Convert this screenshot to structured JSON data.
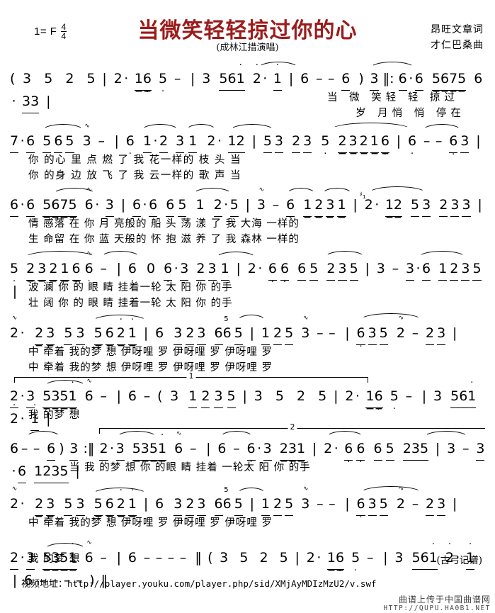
{
  "header": {
    "key_signature": "1= F",
    "time_num": "4",
    "time_den": "4",
    "title": "当微笑轻轻掠过你的心",
    "subtitle": "(成林江措演唱)",
    "lyricist": "昂旺文章词",
    "composer": "才仁巴桑曲",
    "title_color": "#9c1b1b"
  },
  "music": {
    "lines": [
      {
        "id": "line-1",
        "notes": "( 3 5 2 5 | 2 · 16 5 - | 3 561 2 · 1 | 6 - - 6 ) 3 ‖: 6 · 6 5675 6 · 3 3 |",
        "lyric1": "当      微  笑轻    轻  掠过",
        "lyric2": "岁  月悄    悄  停在"
      },
      {
        "id": "line-2",
        "notes": "7 · 6 5 6 5 3 - | 6 1 · 2 3 1 2 · 12 | 5 3 2 3 5 2 3 2 1 6 | 6 - - 6 3 |",
        "lyric1": "你 的心    里    点 燃  了  我    花一样的 枝        头    当",
        "lyric2": "你 的身    边    放 飞  了  我    云一样的 歌        声    当"
      },
      {
        "id": "line-3",
        "notes": "6 · 6 5675 6 · 3 | 6 · 6 6 5 1 2 · 5 | 3 - 6 1 2 3 1 | 2 · 1 2 5 3 2 3 3 |",
        "lyric1": "情 感落   在 你   月 亮般的 船   头    荡 漾 了   我   大海 一样的",
        "lyric2": "生 命留   在 你   蓝 天般的 怀   抱    滋 养 了   我   森林 一样的"
      },
      {
        "id": "line-4",
        "notes": "5 2 3 2 1 6 6 - | 6 0 6 · 3 2 3 1 | 2 · 6 6 6 5 2 3 5 | 3 - 3 · 6 1 2 3 5 |",
        "lyric1": "波      澜      你 的 眼    睛  挂着一轮 太      阳  你 的手",
        "lyric2": "壮      阔      你 的 眼    睛  挂着一轮 太      阳  你 的手"
      },
      {
        "id": "line-5",
        "notes": "2 · 2 3 5 3 5 6 2 1 | 6 3 2 3 6 6 5 | 1 2 5 3 - - | 6 3 5 2 - 2 3 |",
        "lyric1": "中  牵着 我的梦      想 伊呀哩 罗    伊呀哩 罗    伊呀哩 罗",
        "lyric2": "中  牵着 我的梦      想 伊呀哩 罗    伊呀哩 罗    伊呀哩 罗",
        "bracket_label": "1"
      },
      {
        "id": "line-6",
        "notes": "2 · 3 5351 6 - | 6 - ( 3 1 2 3 5 | 3 5 2 5 | 2 · 16 5 - | 3 561 2 · 1 |",
        "lyric1": "我 的梦   想",
        "bracket_label": "2"
      },
      {
        "id": "line-7",
        "notes": "6 - - 6 ) 3 ‖: 2 · 3 5351 6 - | 6 - 6 · 3 231 | 2 · 6 6 6 5 235 | 3 - 3 · 6 1235 |",
        "lyric1": "当  我 的梦    想      你 的眼    睛 挂着 一轮太    阳  你 的手"
      },
      {
        "id": "line-8",
        "notes": "2 · 2 3 5 3 5 6 2 1 | 6 3 2 3 6 6 5 | 1 2 5 3 - - | 6 3 5 2 - 2 3 |",
        "lyric1": "中  牵着 我的梦      想 伊呀哩 罗    伊呀哩 罗    伊呀哩 罗"
      },
      {
        "id": "line-9",
        "notes": "2 · 3 5351 6 - | 6 - - - - ‖ ( 3 5 2 5 | 2 · 16 5 - | 3 561 2 · 1 | 6 - - - - ) ‖",
        "lyric1": "我 的梦   想"
      }
    ]
  },
  "footer": {
    "scribe": "(古弓记谱)",
    "video_label": "视频地址：",
    "video_url": "http://player.youku.com/player.php/sid/XMjAyMDIzMzU2/v.swf",
    "watermark_cn": "曲谱上传于中国曲谱网",
    "watermark_url": "HTTP://QUPU.HA0B1.NET"
  }
}
